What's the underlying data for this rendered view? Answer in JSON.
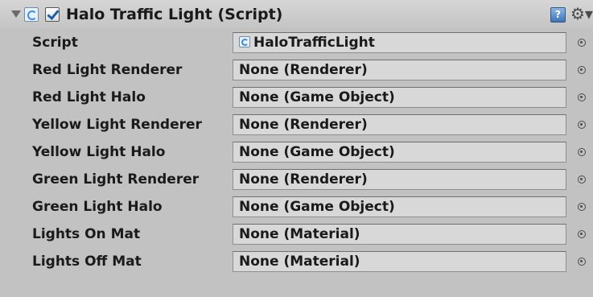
{
  "component": {
    "title": "Halo Traffic Light (Script)",
    "enabled": true,
    "icons": {
      "foldout": "foldout-triangle-icon",
      "script": "script-icon",
      "help": "help-book-icon",
      "settings": "gear-icon",
      "picker": "object-picker-icon"
    },
    "help_glyph": "?",
    "settings_glyph": "⚙▾"
  },
  "properties": [
    {
      "label": "Script",
      "value": "HaloTrafficLight",
      "has_icon": true
    },
    {
      "label": "Red Light Renderer",
      "value": "None (Renderer)"
    },
    {
      "label": "Red Light Halo",
      "value": "None (Game Object)"
    },
    {
      "label": "Yellow Light Renderer",
      "value": "None (Renderer)"
    },
    {
      "label": "Yellow Light Halo",
      "value": "None (Game Object)"
    },
    {
      "label": "Green Light Renderer",
      "value": "None (Renderer)"
    },
    {
      "label": "Green Light Halo",
      "value": "None (Game Object)"
    },
    {
      "label": "Lights On Mat",
      "value": "None (Material)"
    },
    {
      "label": "Lights Off Mat",
      "value": "None (Material)"
    }
  ],
  "colors": {
    "panel_bg": "#c2c2c2",
    "field_bg": "#d8d8d8",
    "text": "#1a1a1a",
    "help_blue": "#3f74b6"
  }
}
